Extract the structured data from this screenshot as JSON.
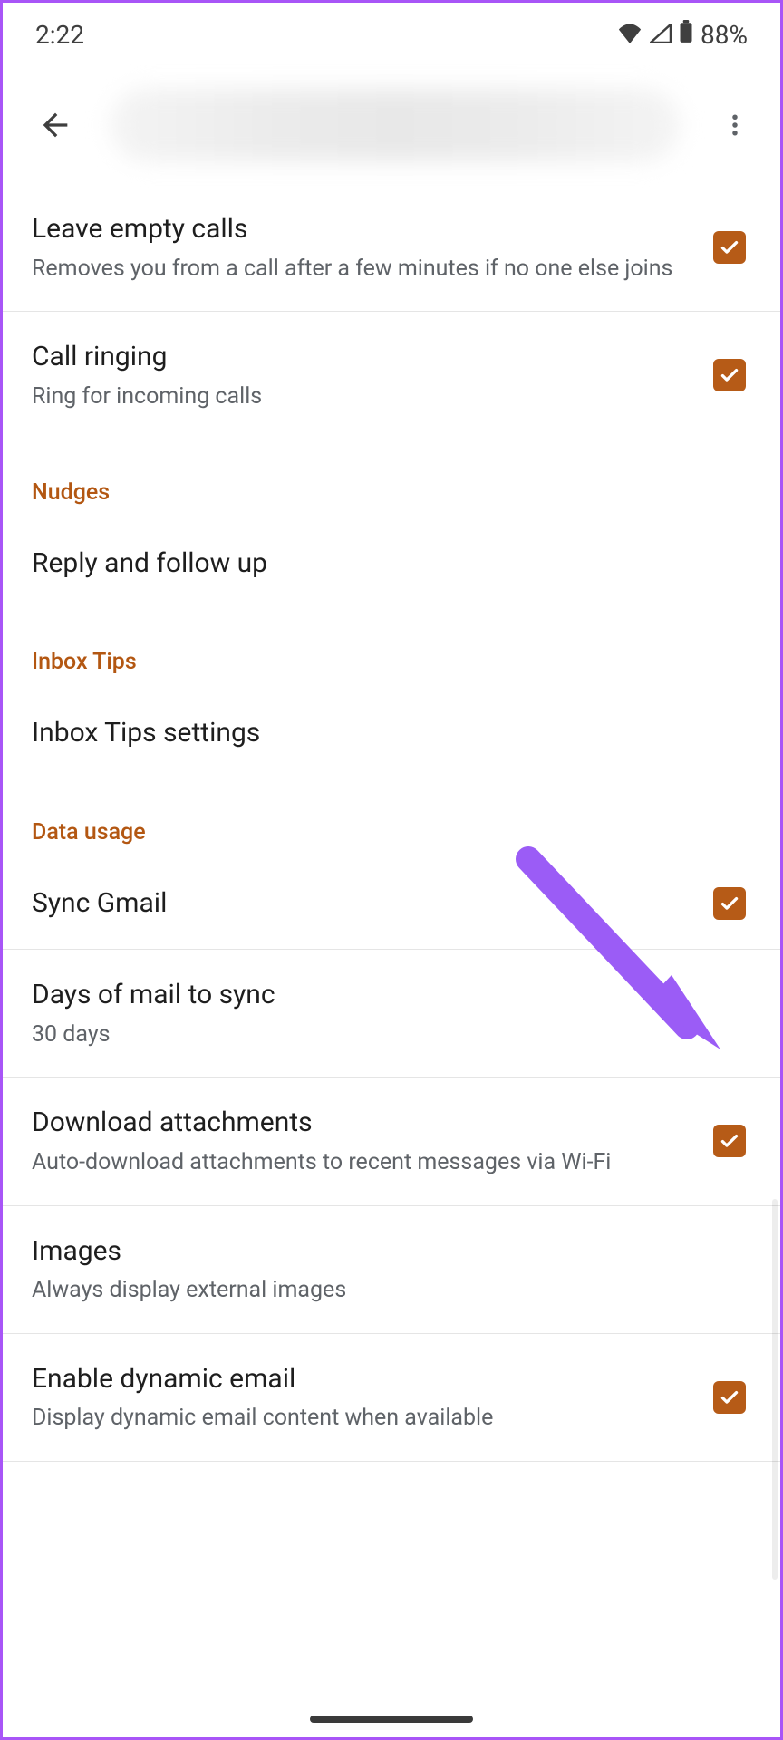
{
  "status": {
    "time": "2:22",
    "battery": "88%"
  },
  "sections": {
    "nudges_header": "Nudges",
    "inbox_tips_header": "Inbox Tips",
    "data_usage_header": "Data usage"
  },
  "items": {
    "leave_empty_calls": {
      "title": "Leave empty calls",
      "sub": "Removes you from a call after a few minutes if no one else joins"
    },
    "call_ringing": {
      "title": "Call ringing",
      "sub": "Ring for incoming calls"
    },
    "reply_follow": {
      "title": "Reply and follow up"
    },
    "inbox_tips_settings": {
      "title": "Inbox Tips settings"
    },
    "sync_gmail": {
      "title": "Sync Gmail"
    },
    "days_sync": {
      "title": "Days of mail to sync",
      "sub": "30 days"
    },
    "download_attachments": {
      "title": "Download attachments",
      "sub": "Auto-download attachments to recent messages via Wi-Fi"
    },
    "images": {
      "title": "Images",
      "sub": "Always display external images"
    },
    "dynamic_email": {
      "title": "Enable dynamic email",
      "sub": "Display dynamic email content when available"
    }
  }
}
